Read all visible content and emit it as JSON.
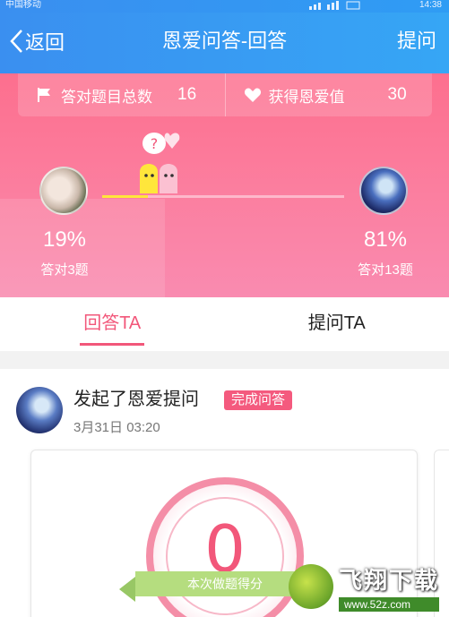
{
  "status_bar": {
    "carrier": "中国移动",
    "time": "14:38"
  },
  "nav": {
    "back_label": "返回",
    "title": "恩爱问答-回答",
    "ask_label": "提问"
  },
  "stats": {
    "correct_label": "答对题目总数",
    "correct_total": "16",
    "love_label": "获得恩爱值",
    "love_value": "30"
  },
  "compare": {
    "left_percent": "19%",
    "left_count": "答对3题",
    "right_percent": "81%",
    "right_count": "答对13题",
    "left_fraction": 0.19
  },
  "tabs": [
    {
      "label": "回答TA",
      "active": true
    },
    {
      "label": "提问TA",
      "active": false
    }
  ],
  "feed": {
    "headline": "发起了恩爱提问",
    "badge": "完成问答",
    "timestamp": "3月31日 03:20",
    "score": "0",
    "score_label": "本次做题得分"
  },
  "watermark": {
    "name": "飞翔下载",
    "url": "www.52z.com"
  },
  "colors": {
    "nav_blue": "#3a8ff0",
    "hero_pink": "#fd6f8e",
    "accent_pink": "#f2577a",
    "ribbon_green": "#b5dd7f"
  }
}
